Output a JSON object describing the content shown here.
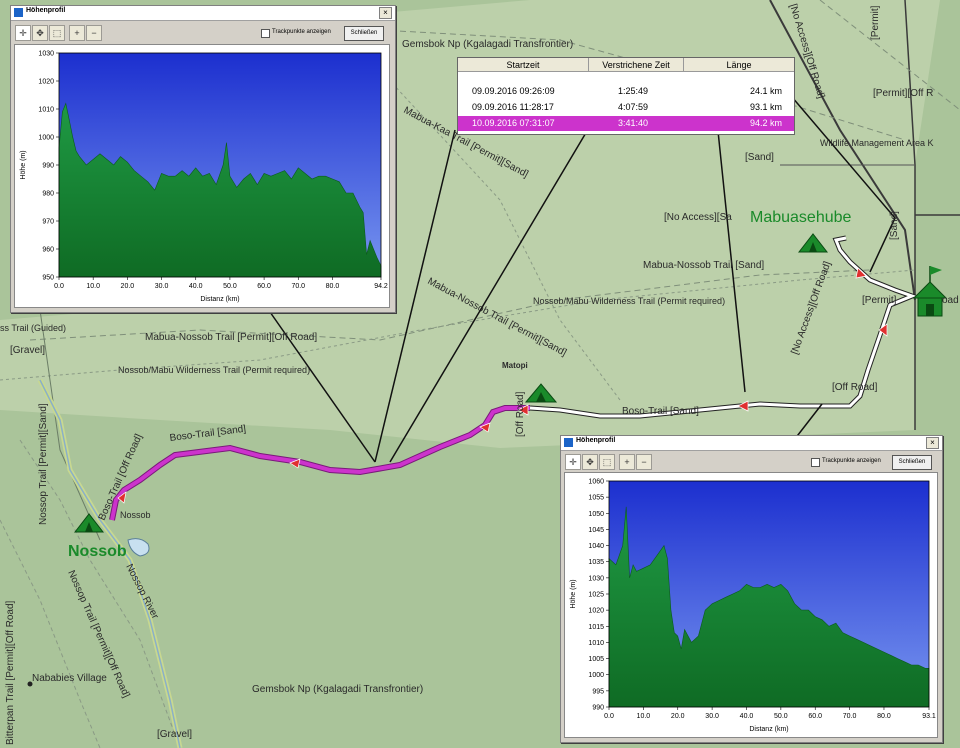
{
  "map": {
    "labels": [
      {
        "text": "Gemsbok Np (Kgalagadi Transfrontier)",
        "size": 10,
        "rot": 0
      },
      {
        "text": "Mabua-Kaa Trail [Permit][Sand]",
        "size": 10,
        "rot": 28
      },
      {
        "text": "[No Access][Off Road]",
        "size": 10,
        "rot": 73
      },
      {
        "text": "[Permit]",
        "size": 10,
        "rot": -90
      },
      {
        "text": "[Permit][Off R",
        "size": 10,
        "rot": 0
      },
      {
        "text": "Wildlife Management Area K",
        "size": 9,
        "rot": 0
      },
      {
        "text": "[Sand]",
        "size": 10,
        "rot": 0
      },
      {
        "text": "[No Access][Sa",
        "size": 10,
        "rot": 0
      },
      {
        "text": "Mabua-Nossob Trail [Sand]",
        "size": 10,
        "rot": 0
      },
      {
        "text": "[Sand]",
        "size": 10,
        "rot": -90
      },
      {
        "text": "Nossob/Mabu Wilderness Trail (Permit required)",
        "size": 9,
        "rot": 0
      },
      {
        "text": "[No Access][Off Road]",
        "size": 10,
        "rot": -70
      },
      {
        "text": "[Permit]",
        "size": 10,
        "rot": 0
      },
      {
        "text": "oad",
        "size": 10,
        "rot": 0
      },
      {
        "text": "Mabua-Nossob Trail [Permit][Sand]",
        "size": 10,
        "rot": 28
      },
      {
        "text": "ss Trail (Guided)",
        "size": 9,
        "rot": 0
      },
      {
        "text": "Mabua-Nossob Trail [Permit][Off Road]",
        "size": 10,
        "rot": 0
      },
      {
        "text": "[Gravel]",
        "size": 10,
        "rot": 0
      },
      {
        "text": "Nossob/Mabu Wilderness Trail (Permit required)",
        "size": 9,
        "rot": 0
      },
      {
        "text": "[Off Road]",
        "size": 10,
        "rot": 0
      },
      {
        "text": "Boso-Trail [Sand]",
        "size": 10,
        "rot": 0
      },
      {
        "text": "[Off Road]",
        "size": 10,
        "rot": -90
      },
      {
        "text": "Boso-Trail [Sand]",
        "size": 10,
        "rot": -7
      },
      {
        "text": "Nossop Trail [Permit][Sand]",
        "size": 10,
        "rot": -90
      },
      {
        "text": "Boso-Trail [Off Road]",
        "size": 10,
        "rot": -66
      },
      {
        "text": "Nossob",
        "size": 9,
        "rot": 0
      },
      {
        "text": "Bitterpan Trail [Permit][Off Road]",
        "size": 10,
        "rot": -90
      },
      {
        "text": "Nossop Trail [Permit][Off Road]",
        "size": 10,
        "rot": 66
      },
      {
        "text": "Nossop River",
        "size": 10,
        "rot": 63
      },
      {
        "text": "Nababies Village",
        "size": 10,
        "rot": 0
      },
      {
        "text": "Gemsbok Np (Kgalagadi Transfrontier)",
        "size": 10,
        "rot": 0
      },
      {
        "text": "[Gravel]",
        "size": 10,
        "rot": 0
      }
    ],
    "places": {
      "matopi": "Matopi",
      "mabuasehube": "Mabuasehube",
      "nossob": "Nossob"
    },
    "colors": {
      "ground": "#aac49a",
      "park": "#bcd0aa",
      "road": "#3a3a3a",
      "track_selected": "#cc33cc",
      "track_other": "#ffffff",
      "river": "#c8d890"
    }
  },
  "tracks_table": {
    "headers": {
      "start": "Startzeit",
      "elapsed": "Verstrichene Zeit",
      "length": "Länge"
    },
    "rows": [
      {
        "start": "09.09.2016 09:26:09",
        "elapsed": "1:25:49",
        "length": "24.1 km",
        "selected": false
      },
      {
        "start": "09.09.2016 11:28:17",
        "elapsed": "4:07:59",
        "length": "93.1 km",
        "selected": false
      },
      {
        "start": "10.09.2016 07:31:07",
        "elapsed": "3:41:40",
        "length": "94.2 km",
        "selected": true
      }
    ]
  },
  "profile_window_1": {
    "title": "Höhenprofil",
    "close_x": "×",
    "checkbox_label": "Trackpunkte anzeigen",
    "checkbox_checked": false,
    "close_button": "Schließen",
    "tool_icons": [
      "crosshair-icon",
      "move-crosshair-icon",
      "zoom-rect-icon",
      "zoom-in-icon",
      "zoom-out-icon"
    ],
    "tool_glyphs": [
      "✛",
      "✥",
      "⬚",
      "+",
      "−"
    ],
    "chart_data": {
      "type": "area",
      "xlabel": "Distanz   (km)",
      "ylabel": "Höhe (m)",
      "ylim": [
        950,
        1030
      ],
      "xlim": [
        0,
        94.2
      ],
      "yticks": [
        "950",
        "960",
        "970",
        "980",
        "990",
        "1000",
        "1010",
        "1020",
        "1030"
      ],
      "xticks": [
        "0.0",
        "10.0",
        "20.0",
        "30.0",
        "40.0",
        "50.0",
        "60.0",
        "70.0",
        "80.0",
        "94.2"
      ],
      "x": [
        0,
        1,
        2,
        3,
        4,
        5,
        6,
        8,
        10,
        12,
        14,
        16,
        18,
        20,
        22,
        24,
        26,
        28,
        30,
        32,
        34,
        36,
        38,
        40,
        42,
        44,
        46,
        48,
        49,
        50,
        52,
        54,
        56,
        58,
        60,
        62,
        64,
        66,
        68,
        70,
        72,
        74,
        76,
        78,
        80,
        82,
        84,
        86,
        88,
        89,
        90,
        91,
        92,
        93,
        94.2
      ],
      "values": [
        996,
        1009,
        1012,
        1006,
        1000,
        995,
        993,
        990,
        992,
        994,
        992,
        990,
        993,
        991,
        988,
        986,
        984,
        981,
        987,
        986,
        986,
        988,
        986,
        989,
        986,
        987,
        983,
        990,
        998,
        986,
        982,
        985,
        987,
        983,
        987,
        986,
        987,
        988,
        985,
        989,
        987,
        985,
        986,
        986,
        985,
        984,
        980,
        980,
        975,
        973,
        958,
        963,
        960,
        957,
        954
      ],
      "fill_top": "#1f9a44",
      "fill_bottom": "#0f6b24",
      "sky_top": "#1c2fcf",
      "sky_bottom": "#7896f0"
    }
  },
  "profile_window_2": {
    "title": "Höhenprofil",
    "close_x": "×",
    "checkbox_label": "Trackpunkte anzeigen",
    "checkbox_checked": false,
    "close_button": "Schließen",
    "tool_icons": [
      "crosshair-icon",
      "move-crosshair-icon",
      "zoom-rect-icon",
      "zoom-in-icon",
      "zoom-out-icon"
    ],
    "tool_glyphs": [
      "✛",
      "✥",
      "⬚",
      "+",
      "−"
    ],
    "chart_data": {
      "type": "area",
      "xlabel": "Distanz   (km)",
      "ylabel": "Höhe (m)",
      "ylim": [
        990,
        1060
      ],
      "xlim": [
        0,
        93.1
      ],
      "yticks": [
        "990",
        "995",
        "1000",
        "1005",
        "1010",
        "1015",
        "1020",
        "1025",
        "1030",
        "1035",
        "1040",
        "1045",
        "1050",
        "1055",
        "1060"
      ],
      "xticks": [
        "0.0",
        "10.0",
        "20.0",
        "30.0",
        "40.0",
        "50.0",
        "60.0",
        "70.0",
        "80.0",
        "93.1"
      ],
      "x": [
        0,
        2,
        4,
        5,
        6,
        7,
        8,
        10,
        12,
        14,
        16,
        17,
        18,
        19,
        20,
        21,
        22,
        24,
        26,
        28,
        30,
        32,
        34,
        36,
        38,
        40,
        42,
        44,
        46,
        48,
        50,
        52,
        54,
        56,
        58,
        60,
        62,
        64,
        66,
        68,
        70,
        72,
        74,
        76,
        78,
        80,
        82,
        84,
        86,
        88,
        90,
        92,
        93.1
      ],
      "values": [
        1036,
        1034,
        1040,
        1052,
        1030,
        1034,
        1032,
        1033,
        1034,
        1037,
        1040,
        1036,
        1020,
        1013,
        1012,
        1008,
        1014,
        1010,
        1012,
        1020,
        1022,
        1023,
        1024,
        1025,
        1026,
        1028,
        1027,
        1027,
        1028,
        1027,
        1028,
        1026,
        1022,
        1020,
        1020,
        1018,
        1017,
        1015,
        1016,
        1013,
        1012,
        1011,
        1010,
        1009,
        1008,
        1007,
        1006,
        1005,
        1004,
        1003,
        1003,
        1002,
        1002
      ],
      "fill_top": "#1f9a44",
      "fill_bottom": "#0f6b24",
      "sky_top": "#1c2fcf",
      "sky_bottom": "#7896f0"
    }
  }
}
